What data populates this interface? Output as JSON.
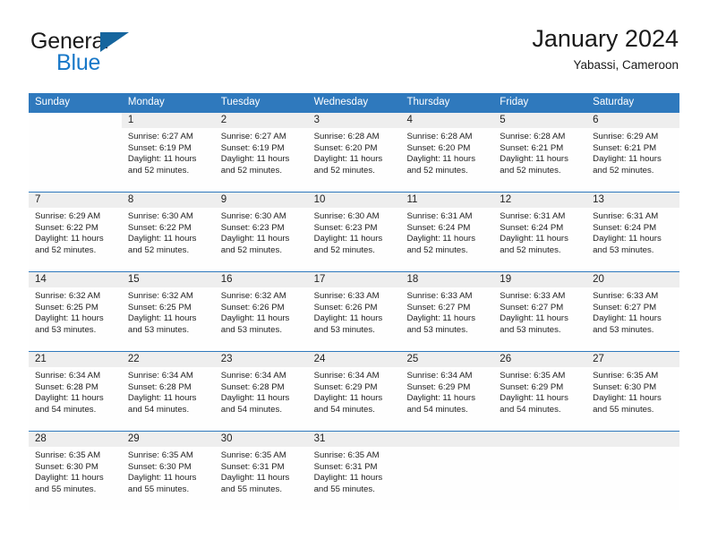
{
  "brand": {
    "name_part1": "General",
    "name_part2": "Blue",
    "accent_color": "#1878c8",
    "triangle_color": "#15659e"
  },
  "header": {
    "title": "January 2024",
    "location": "Yabassi, Cameroon"
  },
  "theme": {
    "header_bar_color": "#2f79bd",
    "row_divider_color": "#2f79bd",
    "day_band_color": "#eeeeee"
  },
  "weekdays": [
    "Sunday",
    "Monday",
    "Tuesday",
    "Wednesday",
    "Thursday",
    "Friday",
    "Saturday"
  ],
  "weeks": [
    [
      {
        "day": "",
        "blank": true,
        "sunrise": "",
        "sunset": "",
        "daylight1": "",
        "daylight2": ""
      },
      {
        "day": "1",
        "sunrise": "Sunrise: 6:27 AM",
        "sunset": "Sunset: 6:19 PM",
        "daylight1": "Daylight: 11 hours",
        "daylight2": "and 52 minutes."
      },
      {
        "day": "2",
        "sunrise": "Sunrise: 6:27 AM",
        "sunset": "Sunset: 6:19 PM",
        "daylight1": "Daylight: 11 hours",
        "daylight2": "and 52 minutes."
      },
      {
        "day": "3",
        "sunrise": "Sunrise: 6:28 AM",
        "sunset": "Sunset: 6:20 PM",
        "daylight1": "Daylight: 11 hours",
        "daylight2": "and 52 minutes."
      },
      {
        "day": "4",
        "sunrise": "Sunrise: 6:28 AM",
        "sunset": "Sunset: 6:20 PM",
        "daylight1": "Daylight: 11 hours",
        "daylight2": "and 52 minutes."
      },
      {
        "day": "5",
        "sunrise": "Sunrise: 6:28 AM",
        "sunset": "Sunset: 6:21 PM",
        "daylight1": "Daylight: 11 hours",
        "daylight2": "and 52 minutes."
      },
      {
        "day": "6",
        "sunrise": "Sunrise: 6:29 AM",
        "sunset": "Sunset: 6:21 PM",
        "daylight1": "Daylight: 11 hours",
        "daylight2": "and 52 minutes."
      }
    ],
    [
      {
        "day": "7",
        "sunrise": "Sunrise: 6:29 AM",
        "sunset": "Sunset: 6:22 PM",
        "daylight1": "Daylight: 11 hours",
        "daylight2": "and 52 minutes."
      },
      {
        "day": "8",
        "sunrise": "Sunrise: 6:30 AM",
        "sunset": "Sunset: 6:22 PM",
        "daylight1": "Daylight: 11 hours",
        "daylight2": "and 52 minutes."
      },
      {
        "day": "9",
        "sunrise": "Sunrise: 6:30 AM",
        "sunset": "Sunset: 6:23 PM",
        "daylight1": "Daylight: 11 hours",
        "daylight2": "and 52 minutes."
      },
      {
        "day": "10",
        "sunrise": "Sunrise: 6:30 AM",
        "sunset": "Sunset: 6:23 PM",
        "daylight1": "Daylight: 11 hours",
        "daylight2": "and 52 minutes."
      },
      {
        "day": "11",
        "sunrise": "Sunrise: 6:31 AM",
        "sunset": "Sunset: 6:24 PM",
        "daylight1": "Daylight: 11 hours",
        "daylight2": "and 52 minutes."
      },
      {
        "day": "12",
        "sunrise": "Sunrise: 6:31 AM",
        "sunset": "Sunset: 6:24 PM",
        "daylight1": "Daylight: 11 hours",
        "daylight2": "and 52 minutes."
      },
      {
        "day": "13",
        "sunrise": "Sunrise: 6:31 AM",
        "sunset": "Sunset: 6:24 PM",
        "daylight1": "Daylight: 11 hours",
        "daylight2": "and 53 minutes."
      }
    ],
    [
      {
        "day": "14",
        "sunrise": "Sunrise: 6:32 AM",
        "sunset": "Sunset: 6:25 PM",
        "daylight1": "Daylight: 11 hours",
        "daylight2": "and 53 minutes."
      },
      {
        "day": "15",
        "sunrise": "Sunrise: 6:32 AM",
        "sunset": "Sunset: 6:25 PM",
        "daylight1": "Daylight: 11 hours",
        "daylight2": "and 53 minutes."
      },
      {
        "day": "16",
        "sunrise": "Sunrise: 6:32 AM",
        "sunset": "Sunset: 6:26 PM",
        "daylight1": "Daylight: 11 hours",
        "daylight2": "and 53 minutes."
      },
      {
        "day": "17",
        "sunrise": "Sunrise: 6:33 AM",
        "sunset": "Sunset: 6:26 PM",
        "daylight1": "Daylight: 11 hours",
        "daylight2": "and 53 minutes."
      },
      {
        "day": "18",
        "sunrise": "Sunrise: 6:33 AM",
        "sunset": "Sunset: 6:27 PM",
        "daylight1": "Daylight: 11 hours",
        "daylight2": "and 53 minutes."
      },
      {
        "day": "19",
        "sunrise": "Sunrise: 6:33 AM",
        "sunset": "Sunset: 6:27 PM",
        "daylight1": "Daylight: 11 hours",
        "daylight2": "and 53 minutes."
      },
      {
        "day": "20",
        "sunrise": "Sunrise: 6:33 AM",
        "sunset": "Sunset: 6:27 PM",
        "daylight1": "Daylight: 11 hours",
        "daylight2": "and 53 minutes."
      }
    ],
    [
      {
        "day": "21",
        "sunrise": "Sunrise: 6:34 AM",
        "sunset": "Sunset: 6:28 PM",
        "daylight1": "Daylight: 11 hours",
        "daylight2": "and 54 minutes."
      },
      {
        "day": "22",
        "sunrise": "Sunrise: 6:34 AM",
        "sunset": "Sunset: 6:28 PM",
        "daylight1": "Daylight: 11 hours",
        "daylight2": "and 54 minutes."
      },
      {
        "day": "23",
        "sunrise": "Sunrise: 6:34 AM",
        "sunset": "Sunset: 6:28 PM",
        "daylight1": "Daylight: 11 hours",
        "daylight2": "and 54 minutes."
      },
      {
        "day": "24",
        "sunrise": "Sunrise: 6:34 AM",
        "sunset": "Sunset: 6:29 PM",
        "daylight1": "Daylight: 11 hours",
        "daylight2": "and 54 minutes."
      },
      {
        "day": "25",
        "sunrise": "Sunrise: 6:34 AM",
        "sunset": "Sunset: 6:29 PM",
        "daylight1": "Daylight: 11 hours",
        "daylight2": "and 54 minutes."
      },
      {
        "day": "26",
        "sunrise": "Sunrise: 6:35 AM",
        "sunset": "Sunset: 6:29 PM",
        "daylight1": "Daylight: 11 hours",
        "daylight2": "and 54 minutes."
      },
      {
        "day": "27",
        "sunrise": "Sunrise: 6:35 AM",
        "sunset": "Sunset: 6:30 PM",
        "daylight1": "Daylight: 11 hours",
        "daylight2": "and 55 minutes."
      }
    ],
    [
      {
        "day": "28",
        "sunrise": "Sunrise: 6:35 AM",
        "sunset": "Sunset: 6:30 PM",
        "daylight1": "Daylight: 11 hours",
        "daylight2": "and 55 minutes."
      },
      {
        "day": "29",
        "sunrise": "Sunrise: 6:35 AM",
        "sunset": "Sunset: 6:30 PM",
        "daylight1": "Daylight: 11 hours",
        "daylight2": "and 55 minutes."
      },
      {
        "day": "30",
        "sunrise": "Sunrise: 6:35 AM",
        "sunset": "Sunset: 6:31 PM",
        "daylight1": "Daylight: 11 hours",
        "daylight2": "and 55 minutes."
      },
      {
        "day": "31",
        "sunrise": "Sunrise: 6:35 AM",
        "sunset": "Sunset: 6:31 PM",
        "daylight1": "Daylight: 11 hours",
        "daylight2": "and 55 minutes."
      },
      {
        "day": "",
        "empty": true,
        "sunrise": "",
        "sunset": "",
        "daylight1": "",
        "daylight2": ""
      },
      {
        "day": "",
        "empty": true,
        "sunrise": "",
        "sunset": "",
        "daylight1": "",
        "daylight2": ""
      },
      {
        "day": "",
        "empty": true,
        "sunrise": "",
        "sunset": "",
        "daylight1": "",
        "daylight2": ""
      }
    ]
  ]
}
